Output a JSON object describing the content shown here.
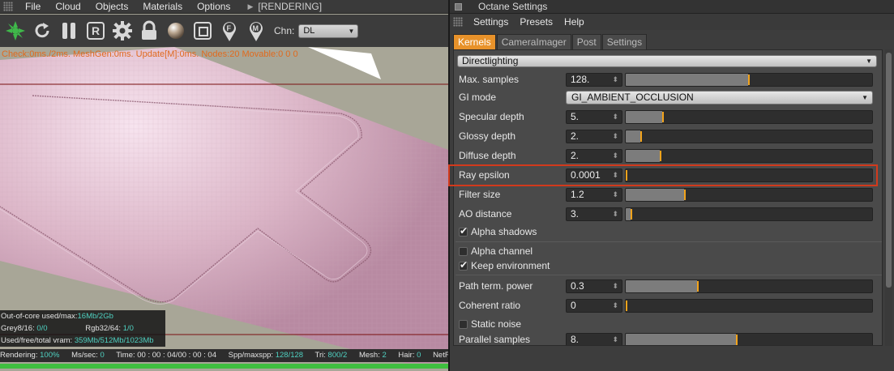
{
  "viewer": {
    "menu": [
      "File",
      "Cloud",
      "Objects",
      "Materials",
      "Options"
    ],
    "status": "[RENDERING]",
    "toolbar_icons": [
      "octane-logo-icon",
      "refresh-icon",
      "pause-icon",
      "region-render-icon",
      "settings-gear-icon",
      "lock-icon",
      "material-sphere-icon",
      "focus-frame-icon",
      "focus-picker-icon",
      "material-picker-icon"
    ],
    "region_label": "R",
    "focus_pin_label": "F",
    "material_pin_label": "M",
    "channel_label": "Chn:",
    "channel_value": "DL",
    "check_line": "Check:0ms./2ms. MeshGen:0ms. Update[M]:0ms. Nodes:20 Movable:0 0 0",
    "stats": {
      "outofcore_label": "Out-of-core used/max:",
      "outofcore_value": "16Mb/2Gb",
      "grey_label": "Grey8/16:",
      "grey_value": "0/0",
      "rgb_label": "Rgb32/64:",
      "rgb_value": "1/0",
      "vram_label": "Used/free/total vram:",
      "vram_value": "359Mb/512Mb/1023Mb"
    },
    "statusbar": {
      "rendering_label": "Rendering:",
      "rendering_value": "100%",
      "mssec_label": "Ms/sec:",
      "mssec_value": "0",
      "time_label": "Time:",
      "time_value": "00 : 00 : 04/00 : 00 : 04",
      "spp_label": "Spp/maxspp:",
      "spp_value": "128/128",
      "tri_label": "Tri:",
      "tri_value": "800/2",
      "mesh_label": "Mesh:",
      "mesh_value": "2",
      "hair_label": "Hair:",
      "hair_value": "0",
      "net_label": "NetRe"
    },
    "progress": 1.0
  },
  "settings": {
    "title": "Octane Settings",
    "menu": [
      "Settings",
      "Presets",
      "Help"
    ],
    "tabs": [
      "Kernels",
      "CameraImager",
      "Post",
      "Settings"
    ],
    "active_tab": "Kernels",
    "kernel": "Directlighting",
    "gi_mode_label": "GI mode",
    "gi_mode_value": "GI_AMBIENT_OCCLUSION",
    "params": [
      {
        "label": "Max. samples",
        "value": "128.",
        "fraction": 0.5
      },
      {
        "label": "Specular depth",
        "value": "5.",
        "fraction": 0.15
      },
      {
        "label": "Glossy depth",
        "value": "2.",
        "fraction": 0.06
      },
      {
        "label": "Diffuse depth",
        "value": "2.",
        "fraction": 0.14
      },
      {
        "label": "Ray epsilon",
        "value": "0.0001",
        "fraction": 0.0
      },
      {
        "label": "Filter size",
        "value": "1.2",
        "fraction": 0.24
      },
      {
        "label": "AO distance",
        "value": "3.",
        "fraction": 0.02
      },
      {
        "label": "Path term. power",
        "value": "0.3",
        "fraction": 0.29
      },
      {
        "label": "Coherent ratio",
        "value": "0",
        "fraction": 0.0
      },
      {
        "label": "Parallel samples",
        "value": "8.",
        "fraction": 0.45
      }
    ],
    "checks": [
      {
        "label": "Alpha shadows",
        "checked": true
      },
      {
        "label": "Alpha channel",
        "checked": false
      },
      {
        "label": "Keep environment",
        "checked": true
      },
      {
        "label": "Static noise",
        "checked": false
      }
    ],
    "highlighted_param": "Ray epsilon",
    "colors": {
      "accent": "#e8922a",
      "slider_knob": "#f2a31b",
      "highlight": "#d23a1c"
    }
  }
}
